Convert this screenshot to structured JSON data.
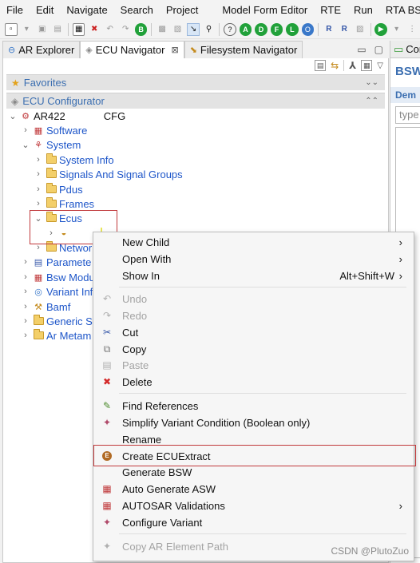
{
  "menubar": [
    "File",
    "Edit",
    "Navigate",
    "Search",
    "Project",
    "Model Form Editor",
    "RTE",
    "Run",
    "RTA BSW"
  ],
  "tabs": [
    {
      "label": "AR Explorer",
      "icon": "explorer-icon"
    },
    {
      "label": "ECU Navigator",
      "icon": "navigator-icon",
      "close": "⊠",
      "active": true
    },
    {
      "label": "Filesystem Navigator",
      "icon": "filesystem-icon"
    }
  ],
  "right_pane": {
    "tab": "Cor",
    "title": "BSW",
    "section": "Dem",
    "filter_placeholder": "type"
  },
  "sections": {
    "favorites": "Favorites",
    "ecu_configurator": "ECU Configurator"
  },
  "tree": [
    {
      "label": "AR422",
      "suffix": "CFG",
      "level": 0,
      "expander": "⌄",
      "black": true
    },
    {
      "label": "Software",
      "level": 1,
      "expander": "›"
    },
    {
      "label": "System",
      "level": 1,
      "expander": "⌄"
    },
    {
      "label": "System Info",
      "level": 2,
      "expander": "›"
    },
    {
      "label": "Signals And Signal Groups",
      "level": 2,
      "expander": "›"
    },
    {
      "label": "Pdus",
      "level": 2,
      "expander": "›"
    },
    {
      "label": "Frames",
      "level": 2,
      "expander": "›"
    },
    {
      "label": "Ecus",
      "level": 2,
      "expander": "⌄"
    },
    {
      "label": "",
      "level": 3,
      "expander": "›"
    },
    {
      "label": "Networ",
      "level": 2,
      "expander": "›"
    },
    {
      "label": "Paramete",
      "level": 1,
      "expander": "›"
    },
    {
      "label": "Bsw Modu",
      "level": 1,
      "expander": "›"
    },
    {
      "label": "Variant Inf",
      "level": 1,
      "expander": "›"
    },
    {
      "label": "Bamf",
      "level": 1,
      "expander": "›"
    },
    {
      "label": "Generic St",
      "level": 1,
      "expander": "›"
    },
    {
      "label": "Ar Metam",
      "level": 1,
      "expander": "›"
    }
  ],
  "context_menu": [
    {
      "label": "New Child",
      "submenu": true
    },
    {
      "label": "Open With",
      "submenu": true
    },
    {
      "label": "Show In",
      "shortcut": "Alt+Shift+W",
      "submenu": true
    },
    {
      "sep": true
    },
    {
      "label": "Undo",
      "disabled": true,
      "icon": "undo-icon"
    },
    {
      "label": "Redo",
      "disabled": true,
      "icon": "redo-icon"
    },
    {
      "label": "Cut",
      "icon": "cut-icon"
    },
    {
      "label": "Copy",
      "icon": "copy-icon"
    },
    {
      "label": "Paste",
      "disabled": true,
      "icon": "paste-icon"
    },
    {
      "label": "Delete",
      "icon": "delete-icon"
    },
    {
      "sep": true
    },
    {
      "label": "Find References",
      "icon": "find-references-icon"
    },
    {
      "label": "Simplify Variant Condition (Boolean only)",
      "icon": "variant-icon"
    },
    {
      "label": "Rename"
    },
    {
      "label": "Create ECUExtract",
      "icon": "ecu-extract-icon",
      "highlighted": true
    },
    {
      "label": "Generate BSW"
    },
    {
      "label": "Auto Generate ASW",
      "icon": "asw-icon"
    },
    {
      "label": "AUTOSAR Validations",
      "icon": "validation-icon",
      "submenu": true
    },
    {
      "label": "Configure Variant",
      "icon": "variant-icon"
    },
    {
      "sep": true
    },
    {
      "label": "Copy AR Element Path",
      "disabled": true,
      "icon": "variant-icon"
    }
  ],
  "watermark": "CSDN @PlutoZuo"
}
